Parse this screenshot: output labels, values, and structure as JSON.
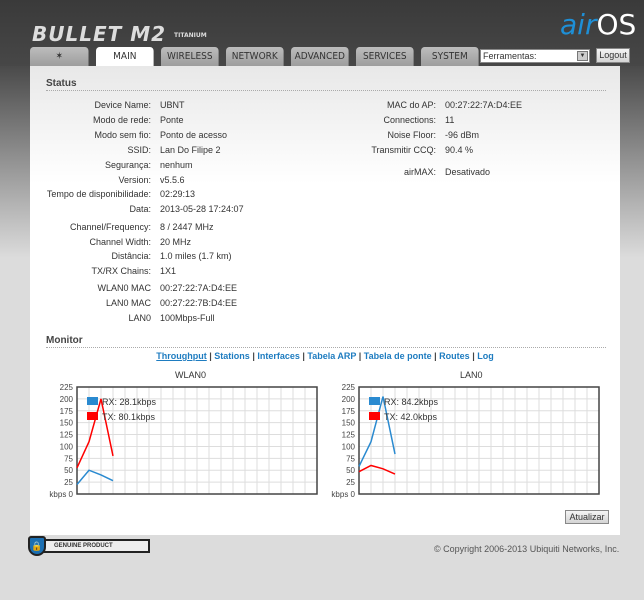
{
  "header": {
    "product": "BULLET M2",
    "edition": "TITANIUM",
    "brand_air": "air",
    "brand_os": "OS",
    "tools_select": "Ferramentas:",
    "logout": "Logout"
  },
  "tabs": [
    {
      "label": "",
      "icon": "ubiquiti-logo-icon"
    },
    {
      "label": "MAIN",
      "active": true
    },
    {
      "label": "WIRELESS"
    },
    {
      "label": "NETWORK"
    },
    {
      "label": "ADVANCED"
    },
    {
      "label": "SERVICES"
    },
    {
      "label": "SYSTEM"
    }
  ],
  "status": {
    "title": "Status",
    "left": [
      {
        "label": "Device Name:",
        "value": "UBNT"
      },
      {
        "label": "Modo de rede:",
        "value": "Ponte"
      },
      {
        "label": "Modo sem fio:",
        "value": "Ponto de acesso"
      },
      {
        "label": "SSID:",
        "value": "Lan Do Filipe 2"
      },
      {
        "label": "Segurança:",
        "value": "nenhum"
      },
      {
        "label": "Version:",
        "value": "v5.5.6"
      },
      {
        "label": "Tempo de disponibilidade:",
        "value": "02:29:13"
      },
      {
        "label": "Data:",
        "value": "2013-05-28 17:24:07"
      },
      {
        "label": "Channel/Frequency:",
        "value": "8 / 2447 MHz"
      },
      {
        "label": "Channel Width:",
        "value": "20 MHz"
      },
      {
        "label": "Distância:",
        "value": "1.0 miles (1.7 km)"
      },
      {
        "label": "TX/RX Chains:",
        "value": "1X1"
      },
      {
        "label": "WLAN0 MAC",
        "value": "00:27:22:7A:D4:EE"
      },
      {
        "label": "LAN0 MAC",
        "value": "00:27:22:7B:D4:EE"
      },
      {
        "label": "LAN0",
        "value": "100Mbps-Full"
      }
    ],
    "right": [
      {
        "label": "MAC do AP:",
        "value": "00:27:22:7A:D4:EE"
      },
      {
        "label": "Connections:",
        "value": "11"
      },
      {
        "label": "Noise Floor:",
        "value": "-96 dBm"
      },
      {
        "label": "Transmitir CCQ:",
        "value": "90.4 %"
      },
      {
        "label": "airMAX:",
        "value": "Desativado"
      }
    ]
  },
  "monitor": {
    "title": "Monitor",
    "links": [
      "Throughput",
      "Stations",
      "Interfaces",
      "Tabela ARP",
      "Tabela de ponte",
      "Routes",
      "Log"
    ],
    "active_link": "Throughput",
    "refresh": "Atualizar"
  },
  "chart_data": [
    {
      "type": "line",
      "title": "WLAN0",
      "ylabel": "kbps",
      "ylim": [
        0,
        225
      ],
      "yticks": [
        0,
        25,
        50,
        75,
        100,
        125,
        150,
        175,
        200,
        225
      ],
      "grid": true,
      "legend": "top-left",
      "series": [
        {
          "name": "RX: 28.1kbps",
          "color": "#2a8ad0",
          "values": [
            20,
            50,
            40,
            28
          ]
        },
        {
          "name": "TX: 80.1kbps",
          "color": "#ff0000",
          "values": [
            55,
            110,
            200,
            80
          ]
        }
      ]
    },
    {
      "type": "line",
      "title": "LAN0",
      "ylabel": "kbps",
      "ylim": [
        0,
        225
      ],
      "yticks": [
        0,
        25,
        50,
        75,
        100,
        125,
        150,
        175,
        200,
        225
      ],
      "grid": true,
      "legend": "top-left",
      "series": [
        {
          "name": "RX: 84.2kbps",
          "color": "#2a8ad0",
          "values": [
            58,
            110,
            205,
            84
          ]
        },
        {
          "name": "TX: 42.0kbps",
          "color": "#ff0000",
          "values": [
            47,
            60,
            53,
            42
          ]
        }
      ]
    }
  ],
  "footer": {
    "badge": "GENUINE PRODUCT",
    "copyright": "© Copyright 2006-2013 Ubiquiti Networks, Inc."
  }
}
